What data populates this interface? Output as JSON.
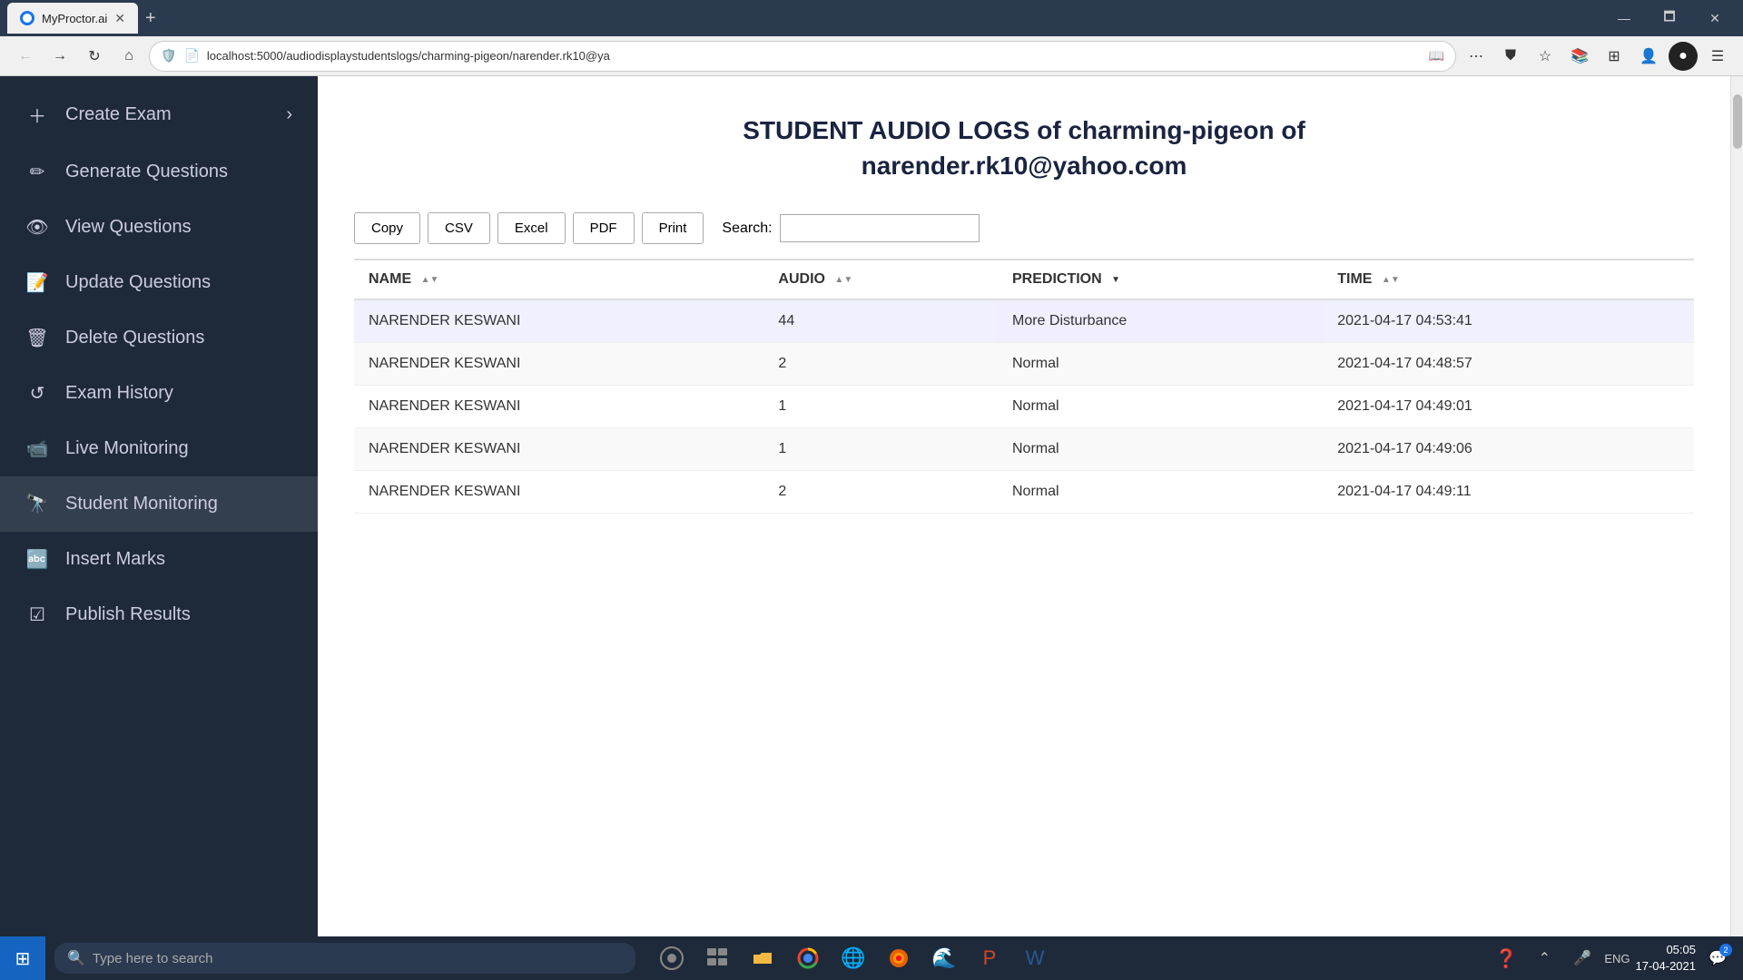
{
  "browser": {
    "tab_title": "MyProctor.ai",
    "tab_favicon": "🔵",
    "address": "localhost:5000/audiodisplaystudentslogs/charming-pigeon/narender.rk10@ya",
    "new_tab_label": "+",
    "minimize": "—",
    "maximize": "🗖",
    "close": "✕"
  },
  "page": {
    "title_line1": "STUDENT AUDIO LOGS of charming-pigeon of",
    "title_line2": "narender.rk10@yahoo.com"
  },
  "toolbar": {
    "copy_label": "Copy",
    "csv_label": "CSV",
    "excel_label": "Excel",
    "pdf_label": "PDF",
    "print_label": "Print",
    "search_label": "Search:",
    "search_placeholder": ""
  },
  "table": {
    "columns": [
      {
        "key": "name",
        "label": "NAME"
      },
      {
        "key": "audio",
        "label": "AUDIO"
      },
      {
        "key": "prediction",
        "label": "PREDICTION"
      },
      {
        "key": "time",
        "label": "TIME"
      }
    ],
    "rows": [
      {
        "name": "NARENDER KESWANI",
        "audio": "44",
        "prediction": "More Disturbance",
        "prediction_type": "more",
        "time": "2021-04-17 04:53:41"
      },
      {
        "name": "NARENDER KESWANI",
        "audio": "2",
        "prediction": "Normal",
        "prediction_type": "normal",
        "time": "2021-04-17 04:48:57"
      },
      {
        "name": "NARENDER KESWANI",
        "audio": "1",
        "prediction": "Normal",
        "prediction_type": "normal",
        "time": "2021-04-17 04:49:01"
      },
      {
        "name": "NARENDER KESWANI",
        "audio": "1",
        "prediction": "Normal",
        "prediction_type": "normal",
        "time": "2021-04-17 04:49:06"
      },
      {
        "name": "NARENDER KESWANI",
        "audio": "2",
        "prediction": "Normal",
        "prediction_type": "normal",
        "time": "2021-04-17 04:49:11"
      }
    ]
  },
  "sidebar": {
    "items": [
      {
        "id": "create-exam",
        "label": "Create Exam",
        "icon": "➕",
        "has_arrow": true
      },
      {
        "id": "generate-questions",
        "label": "Generate Questions",
        "icon": "✏️",
        "has_arrow": false
      },
      {
        "id": "view-questions",
        "label": "View Questions",
        "icon": "👁️",
        "has_arrow": false
      },
      {
        "id": "update-questions",
        "label": "Update Questions",
        "icon": "📝",
        "has_arrow": false
      },
      {
        "id": "delete-questions",
        "label": "Delete Questions",
        "icon": "🗑️",
        "has_arrow": false
      },
      {
        "id": "exam-history",
        "label": "Exam History",
        "icon": "🔄",
        "has_arrow": false
      },
      {
        "id": "live-monitoring",
        "label": "Live Monitoring",
        "icon": "📹",
        "has_arrow": false
      },
      {
        "id": "student-monitoring",
        "label": "Student Monitoring",
        "icon": "🔭",
        "has_arrow": false
      },
      {
        "id": "insert-marks",
        "label": "Insert Marks",
        "icon": "🔤",
        "has_arrow": false
      },
      {
        "id": "publish-results",
        "label": "Publish Results",
        "icon": "☑️",
        "has_arrow": false
      }
    ]
  },
  "taskbar": {
    "search_placeholder": "Type here to search",
    "time": "05:05",
    "date": "17-04-2021",
    "language": "ENG"
  }
}
